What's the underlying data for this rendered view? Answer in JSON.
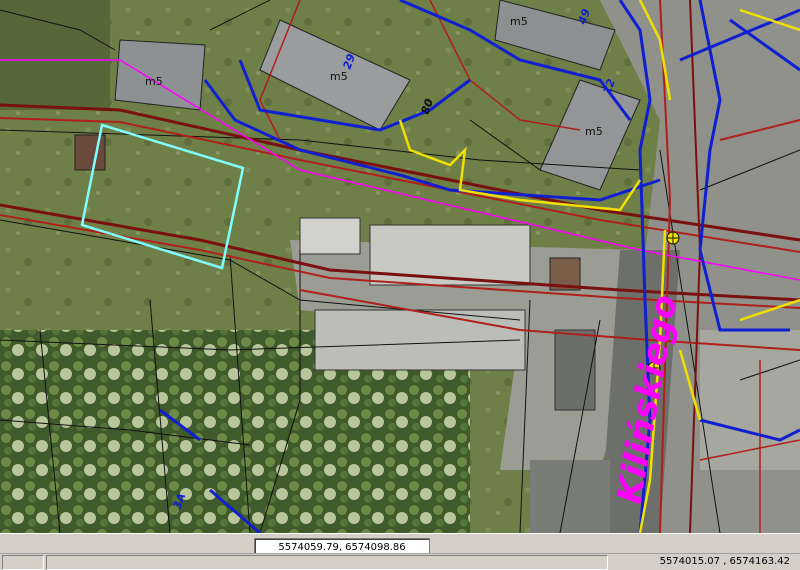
{
  "map": {
    "building_labels": [
      "m5",
      "m5",
      "m5",
      "m5"
    ],
    "street_name": "Kilińskiego",
    "parcel_labels": [
      "3A",
      "29",
      "49",
      "12",
      "80"
    ],
    "colors": {
      "red_lines": "#b0201a",
      "dark_red_lines": "#7a1010",
      "blue_lines": "#1020d0",
      "yellow_lines": "#f0e000",
      "magenta_text": "#ff00ff",
      "cyan_outline": "#80ffff",
      "black_lines": "#111111"
    }
  },
  "cursor_coords": "5574059.79, 6574098.86",
  "status_coords": "5574015.07 , 6574163.42"
}
